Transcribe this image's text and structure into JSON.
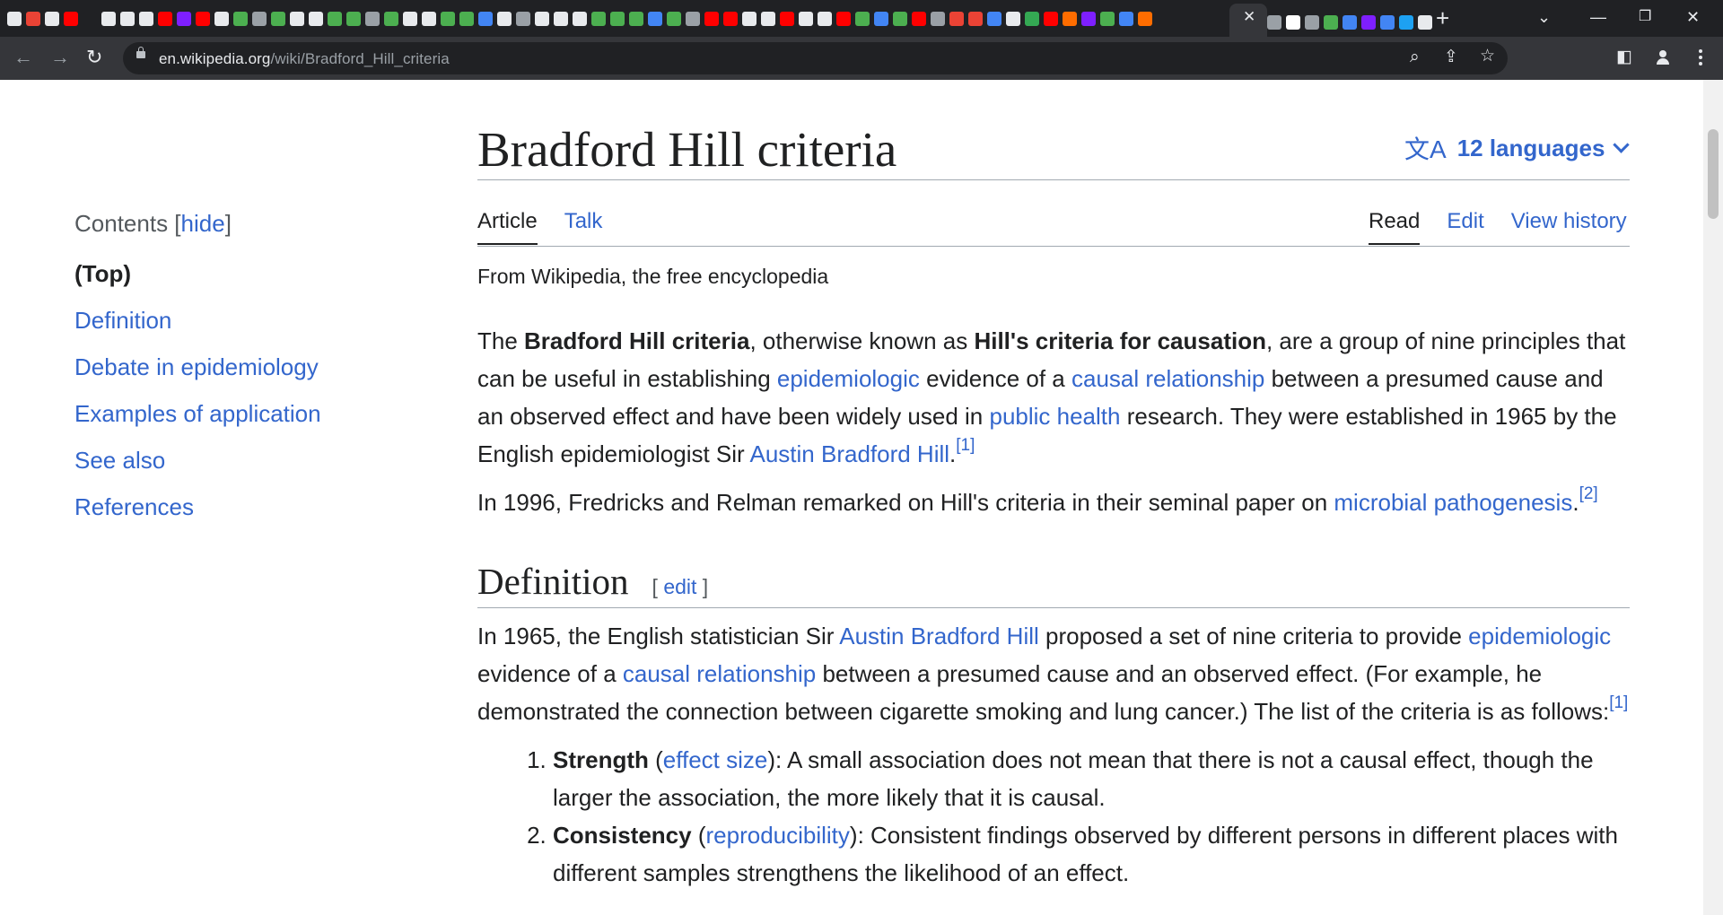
{
  "browser": {
    "active_tab_close": "✕",
    "new_tab": "+",
    "url_host": "en.wikipedia.org",
    "url_path": "/wiki/Bradford_Hill_criteria",
    "favicon_colors": [
      "#e8eaed",
      "#ea4335",
      "#e8eaed",
      "#ff0000",
      "#202124",
      "#e8eaed",
      "#e8eaed",
      "#e8eaed",
      "#ff0000",
      "#7e1fff",
      "#ff0000",
      "#e8eaed",
      "#4caf50",
      "#9aa0a6",
      "#4caf50",
      "#e8eaed",
      "#e8eaed",
      "#4caf50",
      "#4caf50",
      "#9aa0a6",
      "#4caf50",
      "#e8eaed",
      "#e8eaed",
      "#4caf50",
      "#4caf50",
      "#4285f4",
      "#e8eaed",
      "#9aa0a6",
      "#e8eaed",
      "#e8eaed",
      "#e8eaed",
      "#4caf50",
      "#4caf50",
      "#4caf50",
      "#4285f4",
      "#4caf50",
      "#9aa0a6",
      "#ff0000",
      "#ff0000",
      "#e8eaed",
      "#e8eaed",
      "#ff0000",
      "#e8eaed",
      "#e8eaed",
      "#ff0000",
      "#4caf50",
      "#4285f4",
      "#4caf50",
      "#ff0000",
      "#9aa0a6",
      "#ea4335",
      "#ea4335",
      "#4285f4",
      "#e8eaed",
      "#34a853",
      "#ff0000",
      "#ff6d00",
      "#7e1fff",
      "#4caf50",
      "#4285f4",
      "#ff6d00"
    ],
    "favicons_after_active": [
      "#9aa0a6",
      "#ffffff",
      "#9aa0a6",
      "#4caf50",
      "#4285f4",
      "#7e1fff",
      "#4285f4",
      "#1da1f2",
      "#e8eaed"
    ]
  },
  "toc": {
    "title": "Contents",
    "hide_link": "hide",
    "items": [
      "(Top)",
      "Definition",
      "Debate in epidemiology",
      "Examples of application",
      "See also",
      "References"
    ]
  },
  "article": {
    "title": "Bradford Hill criteria",
    "languages": "12 languages",
    "tabs_left": [
      "Article",
      "Talk"
    ],
    "tabs_right": [
      "Read",
      "Edit",
      "View history"
    ],
    "tagline": "From Wikipedia, the free encyclopedia",
    "intro": {
      "t1": "The ",
      "b1": "Bradford Hill criteria",
      "t2": ", otherwise known as ",
      "b2": "Hill's criteria for causation",
      "t3": ", are a group of nine principles that can be useful in establishing ",
      "l1": "epidemiologic",
      "t4": " evidence of a ",
      "l2": "causal relationship",
      "t5": " between a presumed cause and an observed effect and have been widely used in ",
      "l3": "public health",
      "t6": " research. They were established in 1965 by the English epidemiologist Sir ",
      "l4": "Austin Bradford Hill",
      "t7": ".",
      "ref": "[1]"
    },
    "para2": {
      "t1": "In 1996, Fredricks and Relman remarked on Hill's criteria in their seminal paper on ",
      "l1": "microbial pathogenesis",
      "t2": ".",
      "ref": "[2]"
    },
    "definition": {
      "heading": "Definition",
      "edit_open": "[ ",
      "edit": "edit",
      "edit_close": " ]",
      "t1": "In 1965, the English statistician Sir ",
      "l1": "Austin Bradford Hill",
      "t2": " proposed a set of nine criteria to provide ",
      "l2": "epidemiologic",
      "t3": " evidence of a ",
      "l3": "causal relationship",
      "t4": " between a presumed cause and an observed effect. (For example, he demonstrated the connection between cigarette smoking and lung cancer.) The list of the criteria is as follows:",
      "ref": "[1]"
    },
    "criteria": [
      {
        "term": "Strength",
        "open": " (",
        "link": "effect size",
        "rest": "): A small association does not mean that there is not a causal effect, though the larger the association, the more likely that it is causal."
      },
      {
        "term": "Consistency",
        "open": " (",
        "link": "reproducibility",
        "rest": "): Consistent findings observed by different persons in different places with different samples strengthens the likelihood of an effect."
      }
    ]
  }
}
